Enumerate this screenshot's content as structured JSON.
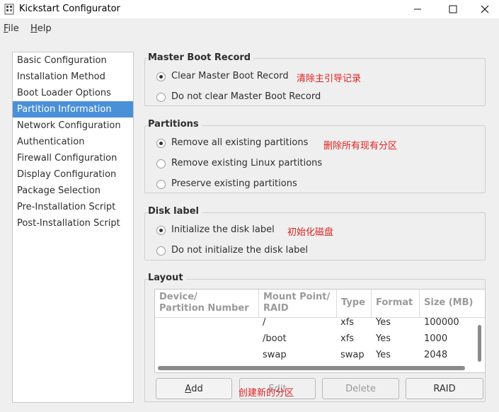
{
  "window": {
    "title": "Kickstart Configurator"
  },
  "menu": [
    {
      "label": "ile",
      "mnemonic": "F"
    },
    {
      "label": "elp",
      "mnemonic": "H"
    }
  ],
  "sidebar": {
    "items": [
      {
        "label": "Basic Configuration",
        "selected": false
      },
      {
        "label": "Installation Method",
        "selected": false
      },
      {
        "label": "Boot Loader Options",
        "selected": false
      },
      {
        "label": "Partition Information",
        "selected": true
      },
      {
        "label": "Network Configuration",
        "selected": false
      },
      {
        "label": "Authentication",
        "selected": false
      },
      {
        "label": "Firewall Configuration",
        "selected": false
      },
      {
        "label": "Display Configuration",
        "selected": false
      },
      {
        "label": "Package Selection",
        "selected": false
      },
      {
        "label": "Pre-Installation Script",
        "selected": false
      },
      {
        "label": "Post-Installation Script",
        "selected": false
      }
    ]
  },
  "mbr": {
    "title": "Master Boot Record",
    "options": [
      {
        "label": "Clear Master Boot Record",
        "checked": true
      },
      {
        "label": "Do not clear Master Boot Record",
        "checked": false
      }
    ],
    "annotation": "清除主引导记录"
  },
  "partitions": {
    "title": "Partitions",
    "options": [
      {
        "label": "Remove all existing partitions",
        "checked": true
      },
      {
        "label": "Remove existing Linux partitions",
        "checked": false
      },
      {
        "label": "Preserve existing partitions",
        "checked": false
      }
    ],
    "annotation": "删除所有现有分区"
  },
  "disklabel": {
    "title": "Disk label",
    "options": [
      {
        "label": "Initialize the disk label",
        "checked": true
      },
      {
        "label": "Do not initialize the disk label",
        "checked": false
      }
    ],
    "annotation": "初始化磁盘"
  },
  "layout": {
    "title": "Layout",
    "columns": [
      "Device/\nPartition Number",
      "Mount Point/\nRAID",
      "Type",
      "Format",
      "Size (MB)"
    ],
    "rows": [
      {
        "device": "",
        "mount": "/",
        "type": "xfs",
        "format": "Yes",
        "size": "100000"
      },
      {
        "device": "",
        "mount": "/boot",
        "type": "xfs",
        "format": "Yes",
        "size": "1000"
      },
      {
        "device": "",
        "mount": "swap",
        "type": "swap",
        "format": "Yes",
        "size": "2048"
      }
    ]
  },
  "buttons": {
    "add": {
      "mnemonic": "A",
      "rest": "dd"
    },
    "edit": "Edit",
    "delete": "Delete",
    "raid": "RAID",
    "annotation": "创建新的分区"
  }
}
